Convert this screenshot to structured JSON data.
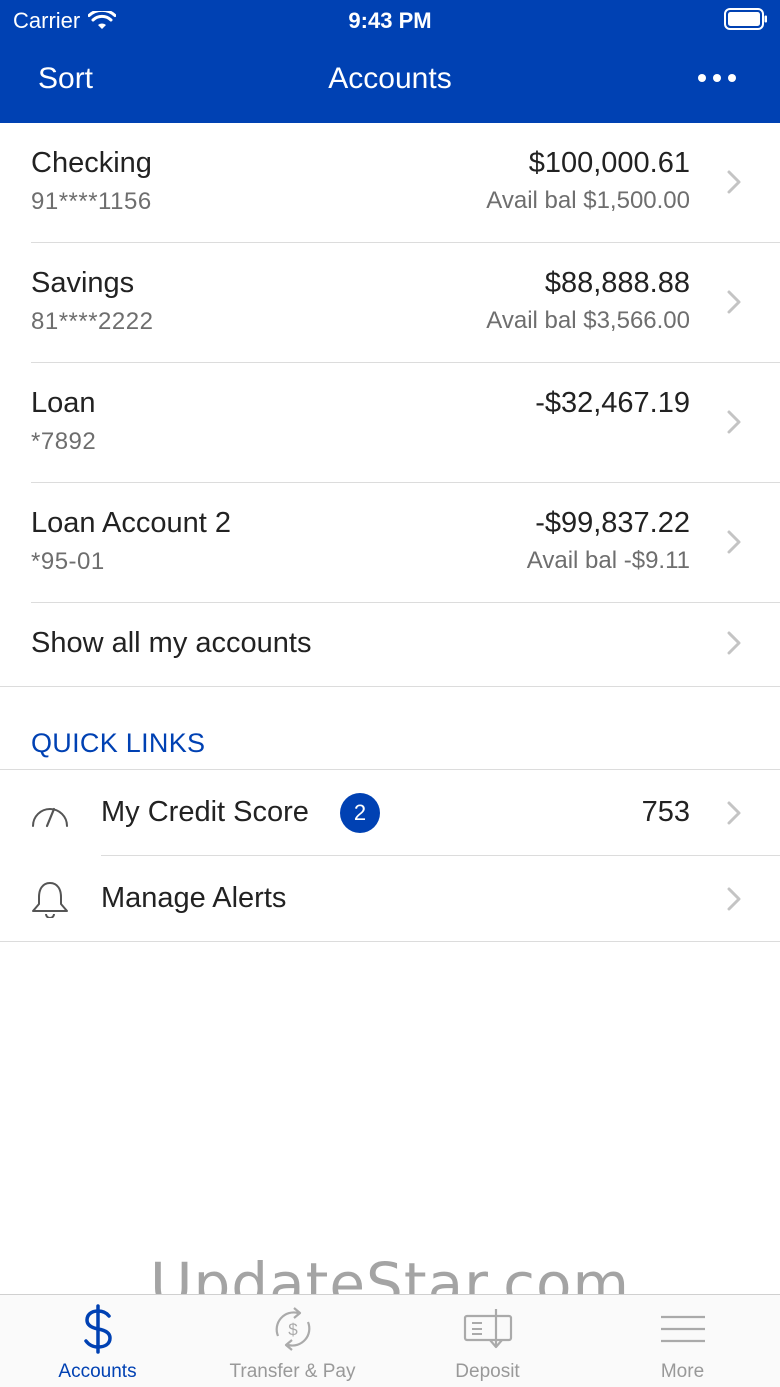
{
  "status_bar": {
    "carrier": "Carrier",
    "time": "9:43 PM"
  },
  "nav": {
    "sort_label": "Sort",
    "title": "Accounts"
  },
  "accounts": [
    {
      "name": "Checking",
      "number": "91****1156",
      "balance": "$100,000.61",
      "avail": "Avail bal $1,500.00"
    },
    {
      "name": "Savings",
      "number": "81****2222",
      "balance": "$88,888.88",
      "avail": "Avail bal $3,566.00"
    },
    {
      "name": "Loan",
      "number": "*7892",
      "balance": "-$32,467.19",
      "avail": ""
    },
    {
      "name": "Loan Account 2",
      "number": "*95-01",
      "balance": "-$99,837.22",
      "avail": "Avail bal -$9.11"
    }
  ],
  "show_all_label": "Show all my accounts",
  "quick_links": {
    "header": "QUICK LINKS",
    "credit_score": {
      "label": "My Credit Score",
      "badge": "2",
      "value": "753",
      "icon": "speedometer-icon"
    },
    "alerts": {
      "label": "Manage Alerts",
      "icon": "bell-icon"
    }
  },
  "watermark": "UpdateStar.com",
  "tabs": [
    {
      "label": "Accounts",
      "icon": "dollar-icon",
      "active": true
    },
    {
      "label": "Transfer & Pay",
      "icon": "transfer-icon",
      "active": false
    },
    {
      "label": "Deposit",
      "icon": "check-deposit-icon",
      "active": false
    },
    {
      "label": "More",
      "icon": "menu-icon",
      "active": false
    }
  ],
  "colors": {
    "brand": "#0041b3",
    "separator": "#dcdcdc",
    "secondary_text": "#6e6e6e",
    "inactive_tab": "#999999"
  }
}
